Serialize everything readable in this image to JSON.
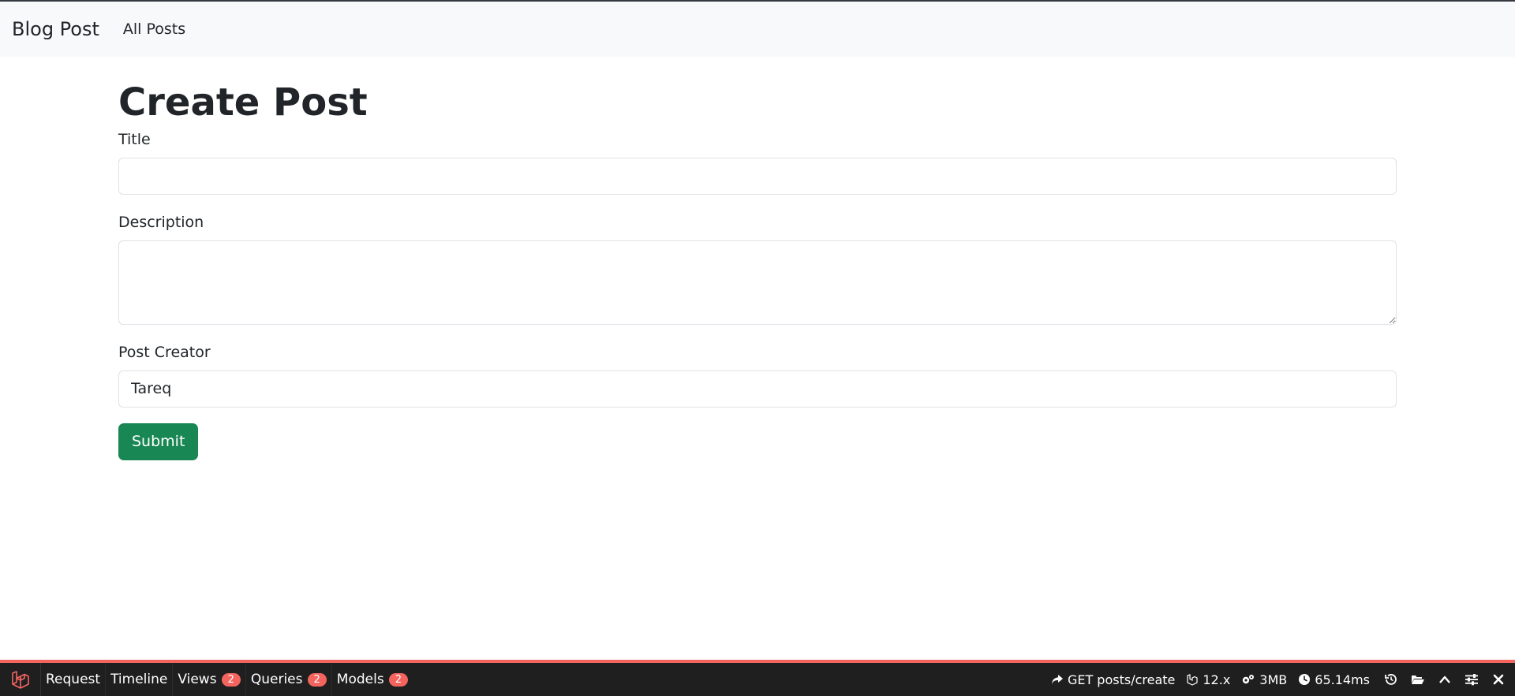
{
  "navbar": {
    "brand": "Blog Post",
    "links": [
      "All Posts"
    ]
  },
  "page": {
    "title": "Create Post"
  },
  "form": {
    "title_label": "Title",
    "title_value": "",
    "description_label": "Description",
    "description_value": "",
    "creator_label": "Post Creator",
    "creator_value": "Tareq",
    "submit_label": "Submit"
  },
  "debugbar": {
    "tabs": [
      {
        "label": "Request"
      },
      {
        "label": "Timeline"
      },
      {
        "label": "Views",
        "badge": "2"
      },
      {
        "label": "Queries",
        "badge": "2"
      },
      {
        "label": "Models",
        "badge": "2"
      }
    ],
    "route": "GET posts/create",
    "version": "12.x",
    "memory": "3MB",
    "time": "65.14ms",
    "accent_color": "#f4645f"
  }
}
